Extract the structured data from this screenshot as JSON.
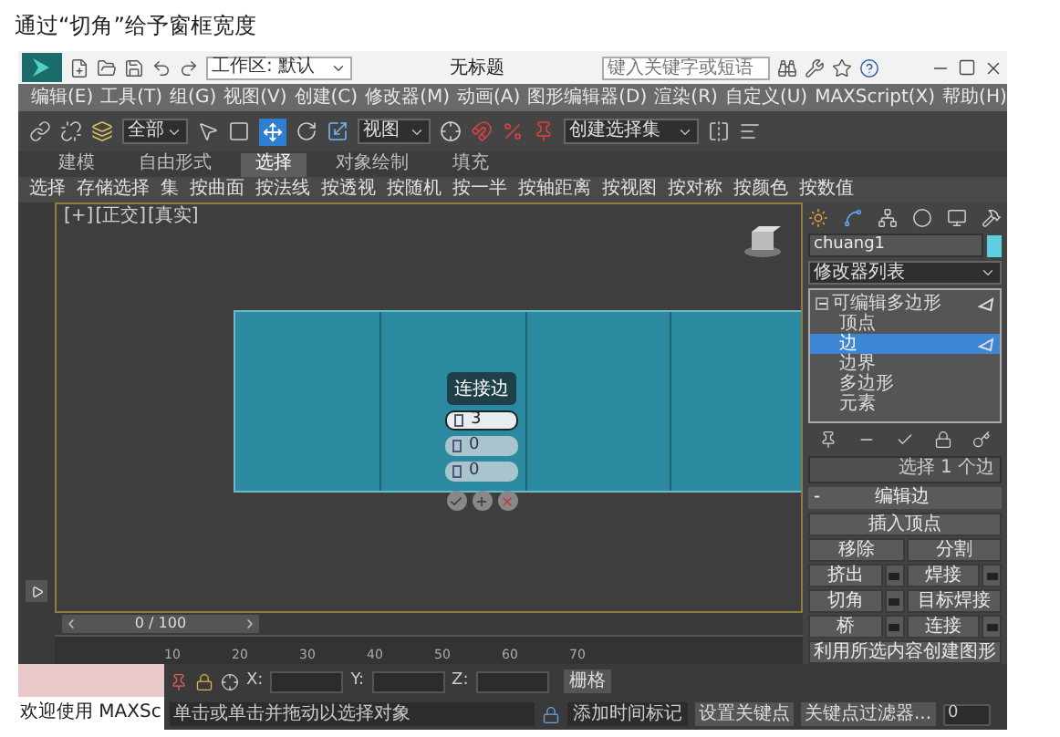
{
  "caption": "通过“切角”给予窗框宽度",
  "window": {
    "title": "无标题",
    "workspace": "工作区: 默认",
    "search": {
      "placeholder": "键入关键字或短语"
    }
  },
  "menu": [
    "编辑(E)",
    "工具(T)",
    "组(G)",
    "视图(V)",
    "创建(C)",
    "修改器(M)",
    "动画(A)",
    "图形编辑器(D)",
    "渲染(R)",
    "自定义(U)",
    "MAXScript(X)",
    "帮助(H)"
  ],
  "toolbar": {
    "selection_filter": "全部",
    "reference_coordinate": "视图",
    "named_selection": "创建选择集"
  },
  "ribbon": {
    "tabs": [
      {
        "label": "建模",
        "selected": false
      },
      {
        "label": "自由形式",
        "selected": false
      },
      {
        "label": "选择",
        "selected": true
      },
      {
        "label": "对象绘制",
        "selected": false
      },
      {
        "label": "填充",
        "selected": false
      }
    ],
    "tools": [
      "选择",
      "存储选择",
      "集",
      "按曲面",
      "按法线",
      "按透视",
      "按随机",
      "按一半",
      "按轴距离",
      "按视图",
      "按对称",
      "按颜色",
      "按数值"
    ]
  },
  "viewport": {
    "labels": [
      "[+]",
      "[正交]",
      "[真实]"
    ]
  },
  "caddy": {
    "title": "连接边",
    "fields": [
      "3",
      "0",
      "0"
    ]
  },
  "command_panel": {
    "object_name": "chuang1",
    "modifier_list": "修改器列表",
    "stack": [
      {
        "label": "可编辑多边形",
        "selected": false,
        "expanded": true,
        "children": [
          {
            "label": "顶点",
            "selected": false
          },
          {
            "label": "边",
            "selected": true
          },
          {
            "label": "边界",
            "selected": false
          },
          {
            "label": "多边形",
            "selected": false
          },
          {
            "label": "元素",
            "selected": false
          }
        ]
      }
    ],
    "selection_info": "选择 1 个边",
    "rollout": {
      "toggle": "-",
      "title": "编辑边",
      "buttons": [
        {
          "label": "插入顶点",
          "kind": "wide"
        },
        {
          "label": "移除",
          "kind": "plain"
        },
        {
          "label": "分割",
          "kind": "plain"
        },
        {
          "label": "挤出",
          "kind": "settings"
        },
        {
          "label": "焊接",
          "kind": "settings"
        },
        {
          "label": "切角",
          "kind": "settings"
        },
        {
          "label": "目标焊接",
          "kind": "plain"
        },
        {
          "label": "桥",
          "kind": "settings"
        },
        {
          "label": "连接",
          "kind": "settings"
        },
        {
          "label": "利用所选内容创建图形",
          "kind": "wide"
        }
      ]
    }
  },
  "time_slider": {
    "label": "0 / 100",
    "level": 0,
    "ticks": [
      "10",
      "20",
      "30",
      "40",
      "50",
      "60",
      "70"
    ]
  },
  "status_bar": {
    "welcome": "欢迎使用 MAXSc",
    "axes": [
      "X:",
      "Y:",
      "Z:"
    ],
    "grid": "栅格",
    "prompt": "单击或单击并拖动以选择对象",
    "add_time_tag": "添加时间标记",
    "set_key": "设置关键点",
    "key_filters": "关键点过滤器...",
    "frame": "0"
  }
}
